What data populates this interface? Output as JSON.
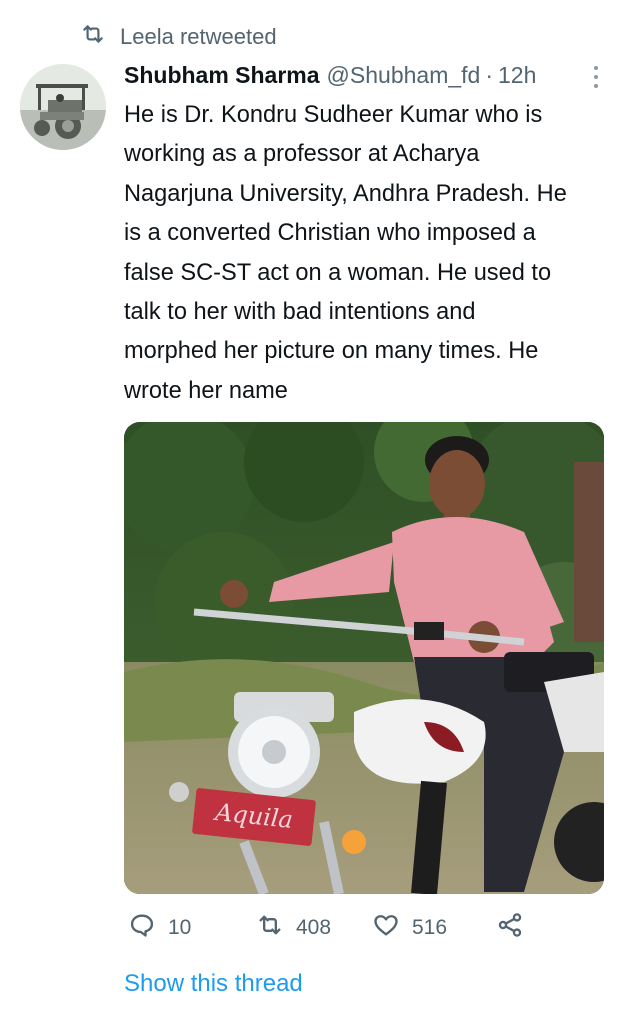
{
  "retweet": {
    "icon": "retweet-icon",
    "label": "Leela retweeted"
  },
  "tweet": {
    "author_name": "Shubham Sharma",
    "handle": "@Shubham_fd",
    "separator": "·",
    "time": "12h",
    "text_lines": [
      "He is Dr. Kondru Sudheer Kumar who is",
      "working as a professor at Acharya",
      "Nagarjuna University, Andhra Pradesh. He",
      "is a converted Christian who imposed a",
      "false SC-ST act on a woman. He used to",
      "talk to her with bad intentions and",
      "morphed her picture on many times. He",
      "wrote her name"
    ],
    "media": {
      "plate_text": "Aquila"
    }
  },
  "actions": {
    "reply_count": "10",
    "retweet_count": "408",
    "like_count": "516"
  },
  "show_thread": "Show this thread",
  "colors": {
    "secondary_text": "#536471",
    "link": "#1d9bf0",
    "primary_text": "#0f1419"
  }
}
